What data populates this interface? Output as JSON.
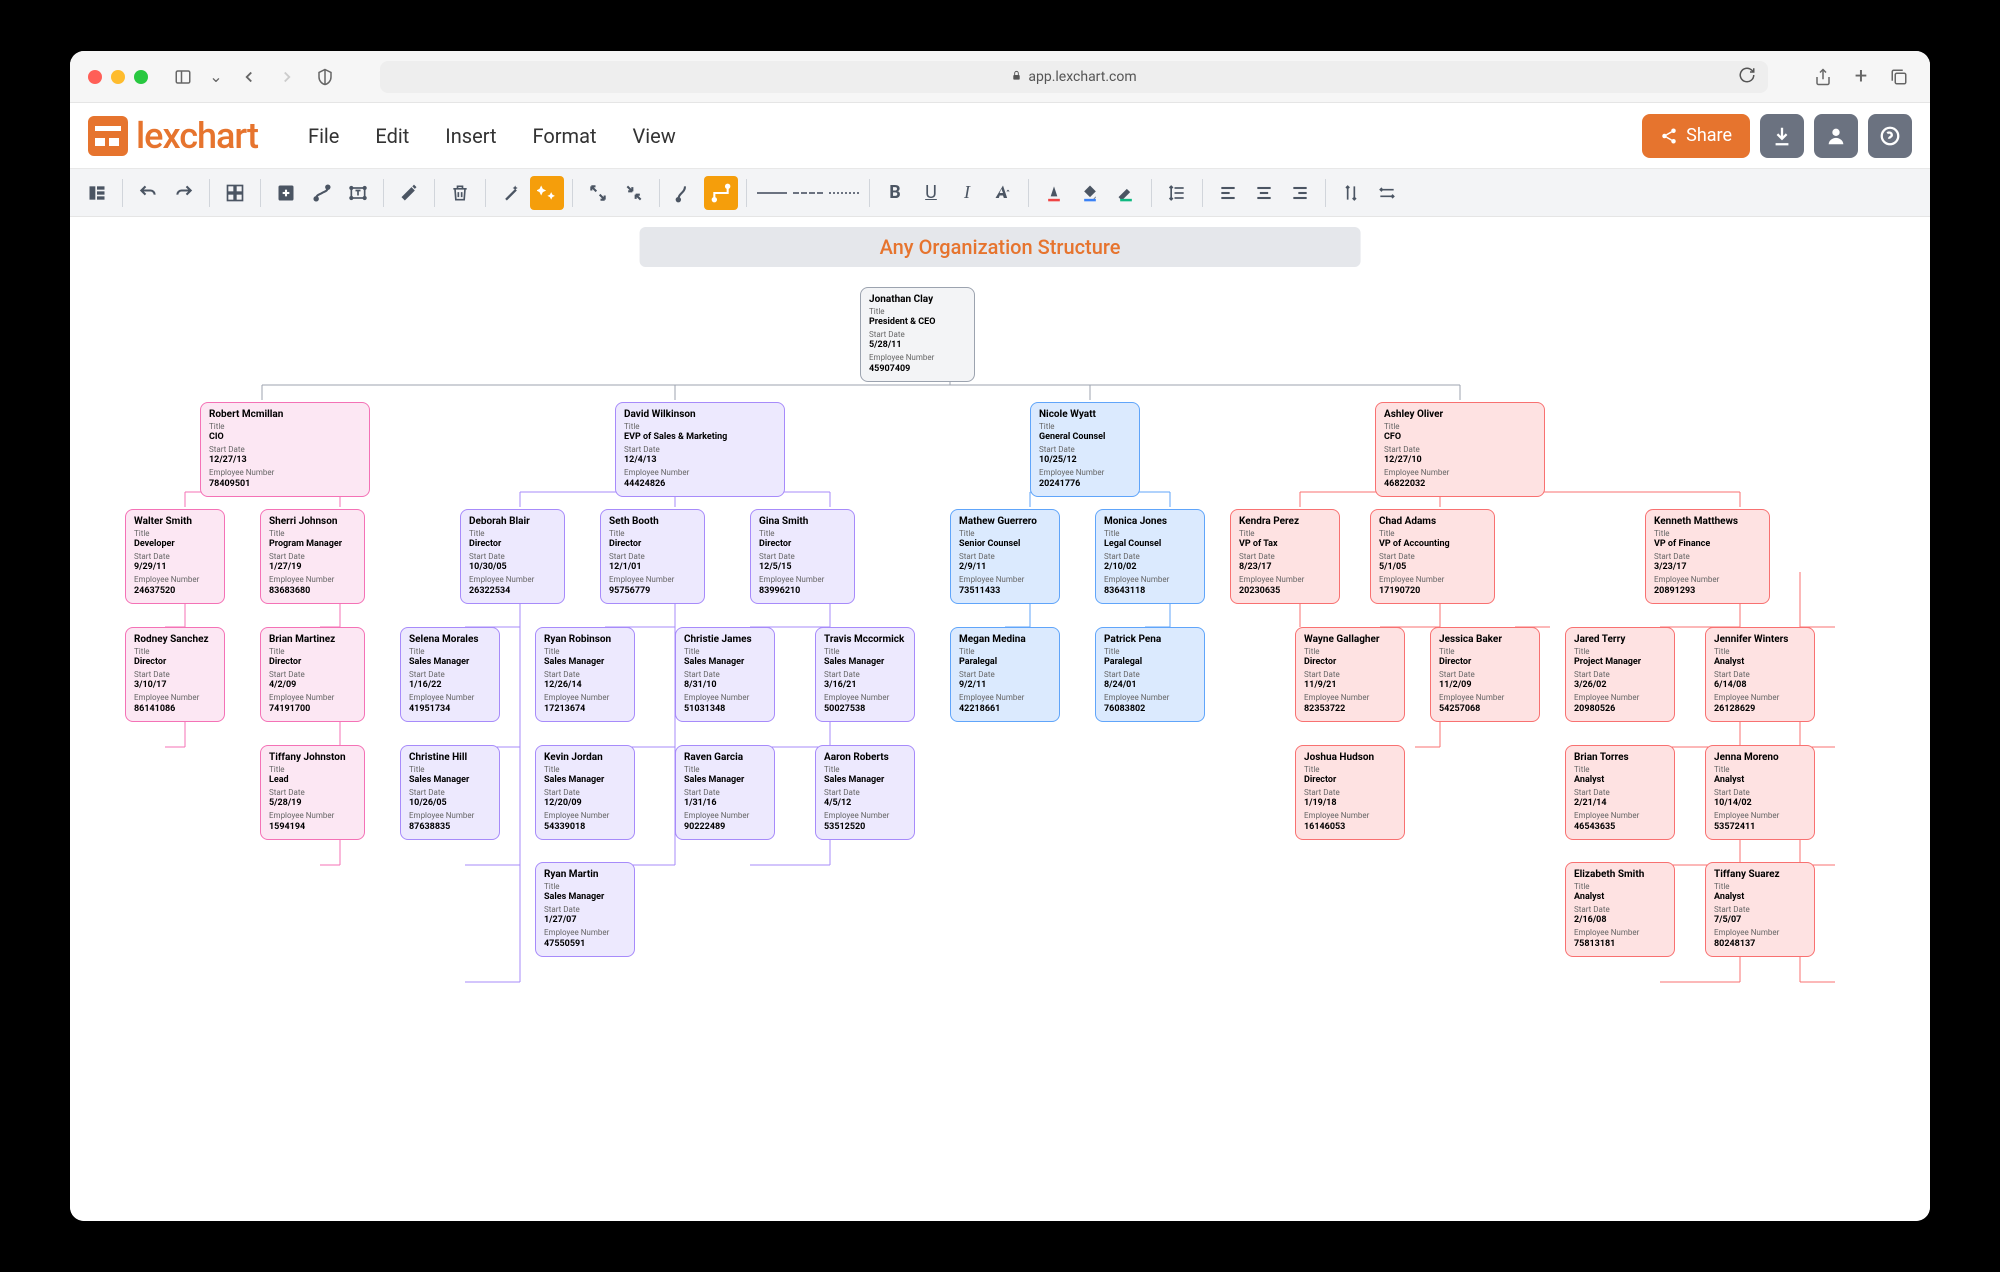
{
  "browser": {
    "url": "app.lexchart.com"
  },
  "app": {
    "logo_text": "lexchart"
  },
  "menu": {
    "file": "File",
    "edit": "Edit",
    "insert": "Insert",
    "format": "Format",
    "view": "View"
  },
  "header": {
    "share": "Share"
  },
  "page": {
    "title": "Any Organization Structure"
  },
  "labels": {
    "title": "Title",
    "start_date": "Start Date",
    "emp_num": "Employee Number"
  },
  "nodes": {
    "ceo": {
      "name": "Jonathan Clay",
      "title": "President & CEO",
      "date": "5/28/11",
      "emp": "45907409"
    },
    "cio": {
      "name": "Robert Mcmillan",
      "title": "CIO",
      "date": "12/27/13",
      "emp": "78409501"
    },
    "evp": {
      "name": "David Wilkinson",
      "title": "EVP of Sales & Marketing",
      "date": "12/4/13",
      "emp": "44424826"
    },
    "gc": {
      "name": "Nicole Wyatt",
      "title": "General Counsel",
      "date": "10/25/12",
      "emp": "20241776"
    },
    "cfo": {
      "name": "Ashley Oliver",
      "title": "CFO",
      "date": "12/27/10",
      "emp": "46822032"
    },
    "wsmith": {
      "name": "Walter Smith",
      "title": "Developer",
      "date": "9/29/11",
      "emp": "24637520"
    },
    "sjohnson": {
      "name": "Sherri Johnson",
      "title": "Program Manager",
      "date": "1/27/19",
      "emp": "83683680"
    },
    "rsanchez": {
      "name": "Rodney Sanchez",
      "title": "Director",
      "date": "3/10/17",
      "emp": "86141086"
    },
    "bmartinez": {
      "name": "Brian Martinez",
      "title": "Director",
      "date": "4/2/09",
      "emp": "74191700"
    },
    "tjohnston": {
      "name": "Tiffany Johnston",
      "title": "Lead",
      "date": "5/28/19",
      "emp": "1594194"
    },
    "dblair": {
      "name": "Deborah Blair",
      "title": "Director",
      "date": "10/30/05",
      "emp": "26322534"
    },
    "sbooth": {
      "name": "Seth Booth",
      "title": "Director",
      "date": "12/1/01",
      "emp": "95756779"
    },
    "gsmith": {
      "name": "Gina Smith",
      "title": "Director",
      "date": "12/5/15",
      "emp": "83996210"
    },
    "smorales": {
      "name": "Selena Morales",
      "title": "Sales Manager",
      "date": "1/16/22",
      "emp": "41951734"
    },
    "rrobinson": {
      "name": "Ryan Robinson",
      "title": "Sales Manager",
      "date": "12/26/14",
      "emp": "17213674"
    },
    "cjames": {
      "name": "Christie James",
      "title": "Sales Manager",
      "date": "8/31/10",
      "emp": "51031348"
    },
    "tmccormick": {
      "name": "Travis Mccormick",
      "title": "Sales Manager",
      "date": "3/16/21",
      "emp": "50027538"
    },
    "chill": {
      "name": "Christine Hill",
      "title": "Sales Manager",
      "date": "10/26/05",
      "emp": "87638835"
    },
    "kjordan": {
      "name": "Kevin Jordan",
      "title": "Sales Manager",
      "date": "12/20/09",
      "emp": "54339018"
    },
    "rgarcia": {
      "name": "Raven Garcia",
      "title": "Sales Manager",
      "date": "1/31/16",
      "emp": "90222489"
    },
    "aroberts": {
      "name": "Aaron Roberts",
      "title": "Sales Manager",
      "date": "4/5/12",
      "emp": "53512520"
    },
    "rmartin": {
      "name": "Ryan Martin",
      "title": "Sales Manager",
      "date": "1/27/07",
      "emp": "47550591"
    },
    "mguerrero": {
      "name": "Mathew Guerrero",
      "title": "Senior Counsel",
      "date": "2/9/11",
      "emp": "73511433"
    },
    "mjones": {
      "name": "Monica Jones",
      "title": "Legal Counsel",
      "date": "2/10/02",
      "emp": "83643118"
    },
    "mmedina": {
      "name": "Megan Medina",
      "title": "Paralegal",
      "date": "9/2/11",
      "emp": "42218661"
    },
    "ppena": {
      "name": "Patrick Pena",
      "title": "Paralegal",
      "date": "8/24/01",
      "emp": "76083802"
    },
    "kperez": {
      "name": "Kendra Perez",
      "title": "VP of Tax",
      "date": "8/23/17",
      "emp": "20230635"
    },
    "cadams": {
      "name": "Chad Adams",
      "title": "VP of Accounting",
      "date": "5/1/05",
      "emp": "17190720"
    },
    "kmatthews": {
      "name": "Kenneth Matthews",
      "title": "VP of Finance",
      "date": "3/23/17",
      "emp": "20891293"
    },
    "wgallagher": {
      "name": "Wayne Gallagher",
      "title": "Director",
      "date": "11/9/21",
      "emp": "82353722"
    },
    "jbaker": {
      "name": "Jessica Baker",
      "title": "Director",
      "date": "11/2/09",
      "emp": "54257068"
    },
    "jterry": {
      "name": "Jared Terry",
      "title": "Project Manager",
      "date": "3/26/02",
      "emp": "20980526"
    },
    "jwinters": {
      "name": "Jennifer Winters",
      "title": "Analyst",
      "date": "6/14/08",
      "emp": "26128629"
    },
    "jhudson": {
      "name": "Joshua Hudson",
      "title": "Director",
      "date": "1/19/18",
      "emp": "16146053"
    },
    "btorres": {
      "name": "Brian Torres",
      "title": "Analyst",
      "date": "2/21/14",
      "emp": "46543635"
    },
    "jmoreno": {
      "name": "Jenna Moreno",
      "title": "Analyst",
      "date": "10/14/02",
      "emp": "53572411"
    },
    "esmith": {
      "name": "Elizabeth Smith",
      "title": "Analyst",
      "date": "2/16/08",
      "emp": "75813181"
    },
    "tsuarez": {
      "name": "Tiffany Suarez",
      "title": "Analyst",
      "date": "7/5/07",
      "emp": "80248137"
    }
  }
}
